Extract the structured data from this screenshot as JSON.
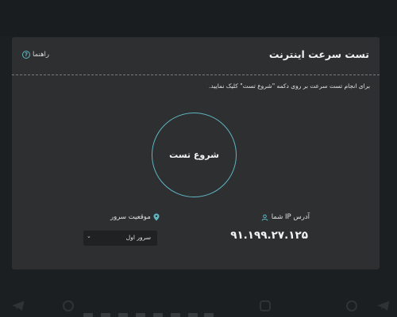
{
  "card": {
    "title": "تست سرعت اینترنت",
    "help_label": "راهنما",
    "instruction": "برای انجام تست سرعت بر روی دکمه \"شروع تست\" کلیک نمایید.",
    "start_button": "شروع تست"
  },
  "ip": {
    "label": "آدرس IP شما",
    "value": "۹۱.۱۹۹.۲۷.۱۲۵"
  },
  "server": {
    "label": "موقعیت سرور",
    "selected": "سرور اول"
  },
  "colors": {
    "accent": "#5fb6c1",
    "card_bg": "#2d2f31",
    "page_bg": "#1c1f21"
  },
  "icons": {
    "help": "question-circle-icon",
    "ip": "user-icon",
    "location": "map-pin-icon",
    "select": "chevron-down-icon"
  }
}
